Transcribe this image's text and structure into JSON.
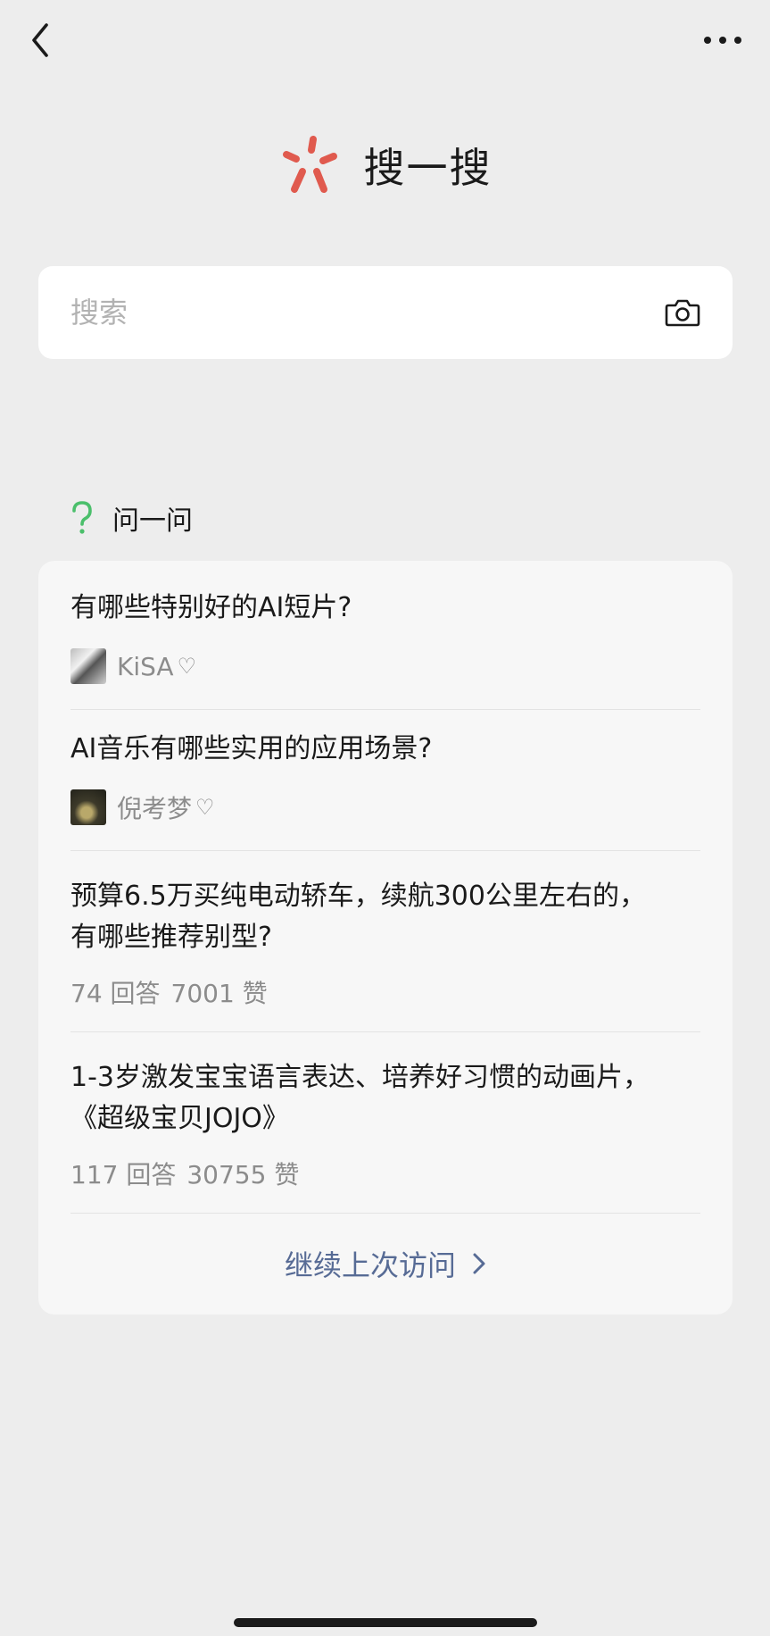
{
  "nav": {
    "back_icon": "chevron-left-icon",
    "more_icon": "more-dots-icon"
  },
  "brand": {
    "title": "搜一搜",
    "logo_icon": "search-star-logo",
    "logo_color": "#e05a4e"
  },
  "search": {
    "placeholder": "搜索",
    "value": "",
    "camera_icon": "camera-icon"
  },
  "ask": {
    "title": "问一问",
    "icon": "question-mark-icon",
    "icon_color": "#4bbf6b",
    "items": [
      {
        "question": "有哪些特别好的AI短片?",
        "author": "KiSA"
      },
      {
        "question": "AI音乐有哪些实用的应用场景?",
        "author": "倪考梦"
      },
      {
        "question_line1": "预算6.5万买纯电动轿车，续航300公里左右的，",
        "question_line2": "有哪些推荐别型?",
        "answers": "74 回答",
        "likes": "7001 赞"
      },
      {
        "question_line1": "1-3岁激发宝宝语言表达、培养好习惯的动画片，",
        "question_line2": "《超级宝贝JOJO》",
        "answers": "117 回答",
        "likes": "30755 赞"
      }
    ],
    "continue_label": "继续上次访问",
    "link_color": "#576b95"
  }
}
